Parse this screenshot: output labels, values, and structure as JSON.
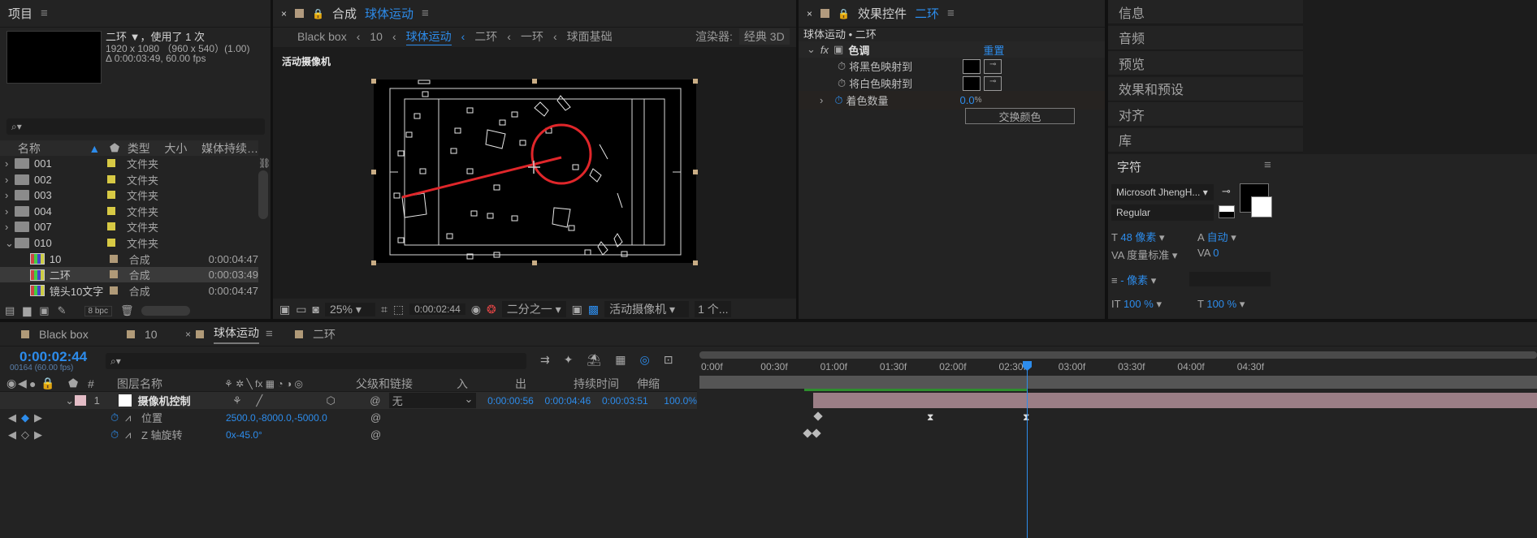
{
  "project": {
    "title": "项目",
    "comp_name": "二环",
    "comp_used": "，使用了 1 次",
    "comp_res": "1920 x 1080 （960 x 540）(1.00)",
    "comp_dur": "Δ 0:00:03:49, 60.00 fps",
    "search_placeholder": "",
    "headers": [
      "名称",
      "类型",
      "大小",
      "媒体持续…"
    ],
    "rows": [
      {
        "name": "001",
        "type": "文件夹",
        "dur": "",
        "kind": "folder"
      },
      {
        "name": "002",
        "type": "文件夹",
        "dur": "",
        "kind": "folder"
      },
      {
        "name": "003",
        "type": "文件夹",
        "dur": "",
        "kind": "folder"
      },
      {
        "name": "004",
        "type": "文件夹",
        "dur": "",
        "kind": "folder"
      },
      {
        "name": "007",
        "type": "文件夹",
        "dur": "",
        "kind": "folder"
      },
      {
        "name": "010",
        "type": "文件夹",
        "dur": "",
        "kind": "folder"
      },
      {
        "name": "10",
        "type": "合成",
        "dur": "0:00:04:47",
        "kind": "comp"
      },
      {
        "name": "二环",
        "type": "合成",
        "dur": "0:00:03:49",
        "kind": "comp"
      },
      {
        "name": "镜头10文字",
        "type": "合成",
        "dur": "0:00:04:47",
        "kind": "comp"
      }
    ],
    "bpc": "8 bpc"
  },
  "comp": {
    "title": "合成",
    "name": "球体运动",
    "breadcrumb": [
      "Black box",
      "10",
      "球体运动",
      "二环",
      "一环",
      "球面基础"
    ],
    "renderer_label": "渲染器:",
    "renderer": "经典 3D",
    "camera_label": "活动摄像机",
    "zoom": "25%",
    "time": "0:00:02:44",
    "quality": "二分之一",
    "view": "活动摄像机",
    "views": "1 个..."
  },
  "effects": {
    "title": "效果控件",
    "target": "二环",
    "subtitle": "球体运动 • 二环",
    "effect_name": "色调",
    "reset": "重置",
    "map_black": "将黑色映射到",
    "map_white": "将白色映射到",
    "amount_label": "着色数量",
    "amount": "0.0",
    "amount_unit": "%",
    "swap": "交换颜色",
    "fx": "fx"
  },
  "right": {
    "items": [
      "信息",
      "音频",
      "预览",
      "效果和预设",
      "对齐",
      "库"
    ],
    "char_title": "字符",
    "font": "Microsoft JhengH...",
    "style": "Regular",
    "size": "48 像素",
    "leading": "自动",
    "kerning": "度量标准",
    "tracking": "0",
    "stroke": "- 像素",
    "vscale": "100 %",
    "hscale": "100 %"
  },
  "timeline": {
    "tabs": [
      "Black box",
      "10",
      "球体运动",
      "二环"
    ],
    "time": "0:00:02:44",
    "frame": "00164 (60.00 fps)",
    "col_name": "图层名称",
    "col_parent": "父级和链接",
    "col_in": "入",
    "col_out": "出",
    "col_dur": "持续时间",
    "col_stretch": "伸缩",
    "layer_num": "1",
    "layer_name": "摄像机控制",
    "parent": "无",
    "in": "0:00:00:56",
    "out": "0:00:04:46",
    "dur": "0:00:03:51",
    "stretch": "100.0%",
    "prop1": "位置",
    "prop1_val": "2500.0,-8000.0,-5000.0",
    "prop2": "Z 轴旋转",
    "prop2_val": "0x-45.0°",
    "ruler": [
      "0:00f",
      "00:30f",
      "01:00f",
      "01:30f",
      "02:00f",
      "02:30f",
      "03:00f",
      "03:30f",
      "04:00f",
      "04:30f"
    ]
  },
  "colors": {
    "accent": "#2d8ceb",
    "red": "#e0262a",
    "layer": "#9b7e86"
  }
}
